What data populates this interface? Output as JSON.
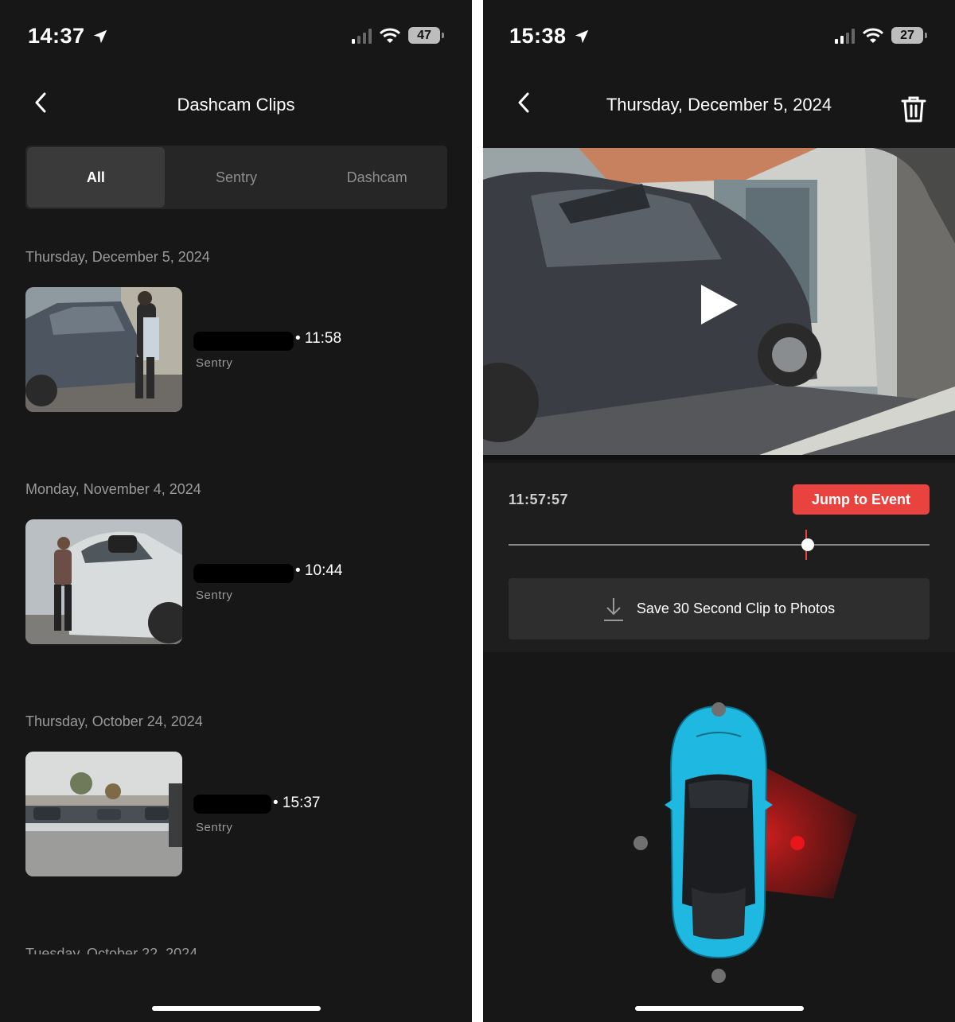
{
  "left": {
    "status_bar": {
      "time": "14:37",
      "battery": "47"
    },
    "title": "Dashcam Clips",
    "tabs": [
      {
        "label": "All",
        "active": true
      },
      {
        "label": "Sentry",
        "active": false
      },
      {
        "label": "Dashcam",
        "active": false
      }
    ],
    "groups": [
      {
        "date": "Thursday, December 5, 2024",
        "clip": {
          "time": "• 11:58",
          "type": "Sentry"
        }
      },
      {
        "date": "Monday, November 4, 2024",
        "clip": {
          "time": "• 10:44",
          "type": "Sentry"
        }
      },
      {
        "date": "Thursday, October 24, 2024",
        "clip": {
          "time": "• 15:37",
          "type": "Sentry"
        }
      },
      {
        "date": "Tuesday, October 22, 2024"
      }
    ]
  },
  "right": {
    "status_bar": {
      "time": "15:38",
      "battery": "27"
    },
    "title": "Thursday, December 5, 2024",
    "timestamp": "11:57:57",
    "jump_label": "Jump to Event",
    "save_label": "Save 30 Second Clip to Photos",
    "playback_position": 0.71,
    "event_position": 0.707
  },
  "colors": {
    "accent_red": "#e8433e",
    "car": "#1fb8e0",
    "background": "#171717"
  }
}
